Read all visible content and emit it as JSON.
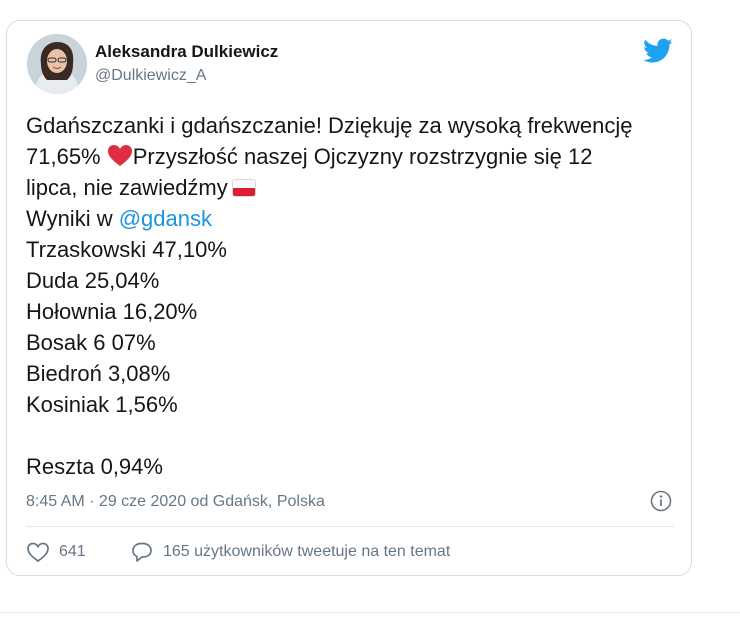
{
  "author": {
    "name": "Aleksandra Dulkiewicz",
    "handle": "@Dulkiewicz_A"
  },
  "tweet": {
    "line1": "Gdańszczanki i gdańszczanie! Dziękuję za wysoką frekwencję",
    "line2_prefix": "71,65%",
    "line2_suffix": "Przyszłość naszej Ojczyzny rozstrzygnie się 12",
    "line3": "lipca, nie zawiedźmy",
    "results_prefix": "Wyniki w",
    "mention": "@gdansk",
    "results": [
      "Trzaskowski 47,10%",
      "Duda 25,04%",
      "Hołownia 16,20%",
      "Bosak 6 07%",
      "Biedroń 3,08%",
      "Kosiniak 1,56%"
    ],
    "rest": "Reszta 0,94%"
  },
  "meta": {
    "timestamp": "8:45 AM · 29 cze 2020 od Gdańsk, Polska"
  },
  "actions": {
    "likes": "641",
    "conversation": "165 użytkowników tweetuje na ten temat"
  },
  "icons": {
    "bird": "twitter-bird-icon",
    "heart_emoji": "red-heart-emoji",
    "flag": "poland-flag-emoji",
    "info": "info-icon",
    "like": "heart-outline-icon",
    "reply": "speech-bubble-icon"
  },
  "colors": {
    "brand": "#1da1f2",
    "link": "#1b95e0",
    "muted": "#657786",
    "heart": "#e0245e",
    "flag_red": "#dc1e35"
  }
}
